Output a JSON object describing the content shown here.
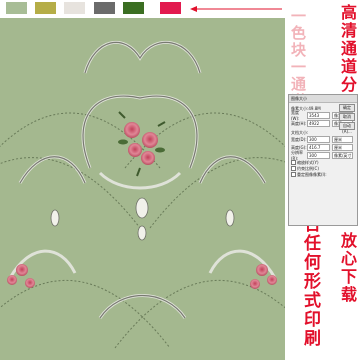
{
  "swatches": {
    "colors": [
      "#a8bd96",
      "#b5ad47",
      "#e7e3de",
      "#6b6b6b",
      "#3b6e22",
      "#e21a4e"
    ]
  },
  "arrow": {
    "color": "#e2102b",
    "icon": "arrow-left-icon"
  },
  "annotations": {
    "channel_title": "高清通道分层",
    "channel_sub": "一色块一通道",
    "print_note": "适合任何形式印刷",
    "download_note": "放心下载"
  },
  "dialog": {
    "title": "图像大小",
    "pixel_dim_label": "像素大小:49.8M",
    "width_label": "宽度(W):",
    "width_value": "3543",
    "height_label": "高度(H):",
    "height_value": "4922",
    "pixel_unit": "像素",
    "doc_size_label": "文档大小:",
    "doc_width_label": "宽度(D):",
    "doc_width_value": "300",
    "doc_height_label": "高度(G):",
    "doc_height_value": "416.7",
    "cm_unit": "厘米",
    "resolution_label": "分辨率(R):",
    "resolution_value": "300",
    "resolution_unit": "像素/英寸",
    "scale_styles": "缩放样式(Y)",
    "constrain": "约束比例(C)",
    "resample": "重定图像像素(I):",
    "ok": "确定",
    "cancel": "取消",
    "auto": "自动(A)..."
  }
}
